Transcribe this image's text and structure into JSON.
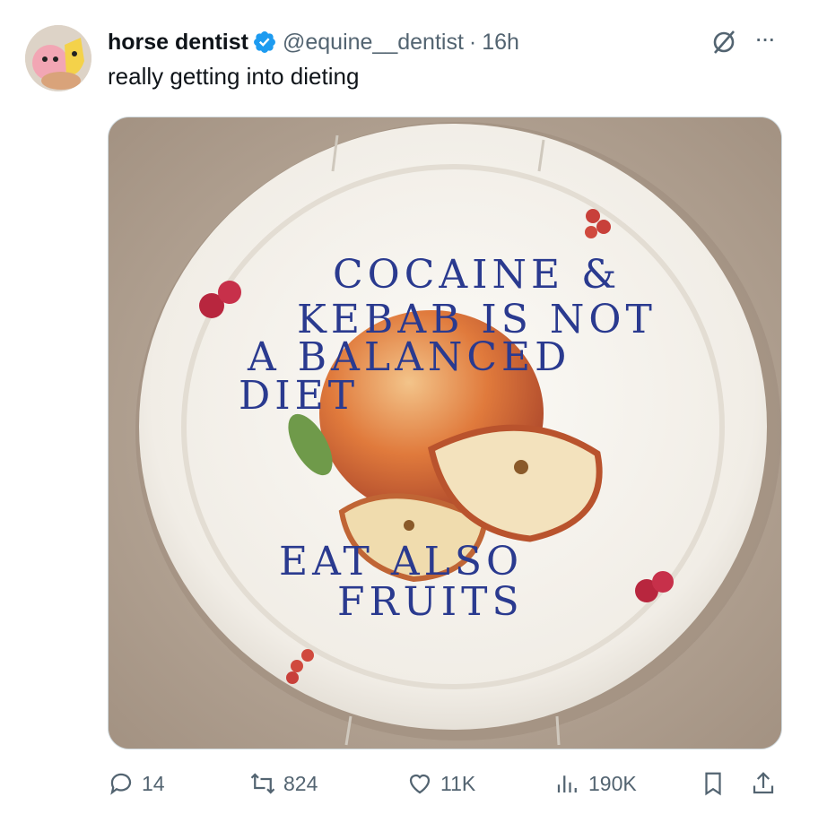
{
  "tweet": {
    "author_name": "horse dentist",
    "handle": "@equine__dentist",
    "separator": "·",
    "time": "16h",
    "text": "really getting into dieting",
    "more_label": "···"
  },
  "media": {
    "plate_lines": [
      "COCAINE &",
      "KEBAB IS NOT",
      "A BALANCED",
      "DIET",
      "EAT ALSO",
      "FRUITS"
    ]
  },
  "actions": {
    "replies": "14",
    "reposts": "824",
    "likes": "11K",
    "views": "190K"
  },
  "colors": {
    "verified": "#1d9bf0",
    "secondary_text": "#536471",
    "plate_lettering": "#2a3a8f"
  }
}
